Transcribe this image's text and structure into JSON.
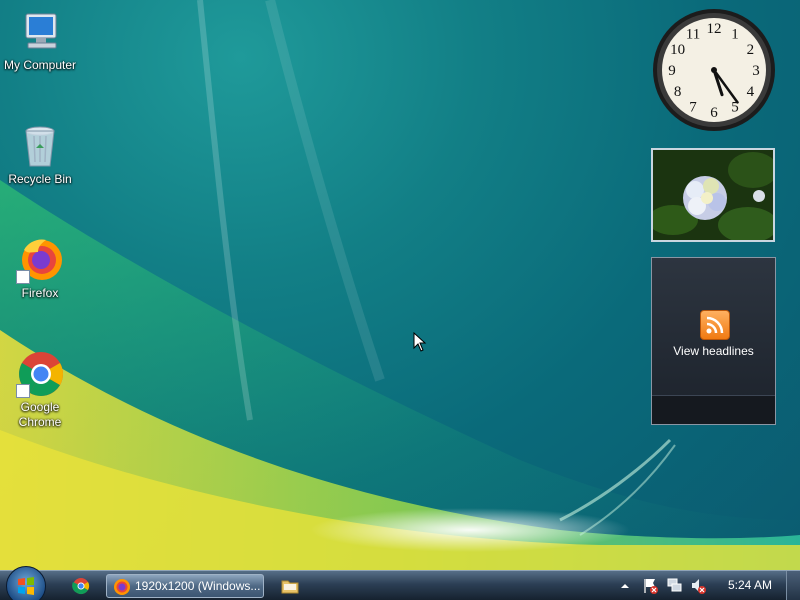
{
  "desktop": {
    "icons": [
      {
        "label": "My Computer",
        "icon": "computer-icon"
      },
      {
        "label": "Recycle Bin",
        "icon": "recycle-bin-icon"
      },
      {
        "label": "Firefox",
        "icon": "firefox-icon"
      },
      {
        "label": "Google Chrome",
        "icon": "chrome-icon"
      }
    ]
  },
  "gadgets": {
    "clock": {
      "time": "5:24",
      "numbers": [
        "12",
        "1",
        "2",
        "3",
        "4",
        "5",
        "6",
        "7",
        "8",
        "9",
        "10",
        "11"
      ]
    },
    "slideshow": {
      "subject": "hydrangea flower"
    },
    "feed": {
      "label": "View headlines",
      "icon": "rss-icon"
    }
  },
  "taskbar": {
    "start_icon": "windows-logo-icon",
    "quicklaunch": [
      "chrome-icon"
    ],
    "task": {
      "label": "1920x1200 (Windows...",
      "icon": "firefox-icon"
    },
    "explorer_icon": "folder-icon",
    "tray": {
      "chevron": "chevron-up-icon",
      "icons": [
        "action-center-flag-icon",
        "network-icon",
        "volume-muted-icon"
      ],
      "time": "5:24 AM"
    }
  },
  "colors": {
    "accent": "#1a8a94",
    "taskbar": "#2c3f55"
  }
}
